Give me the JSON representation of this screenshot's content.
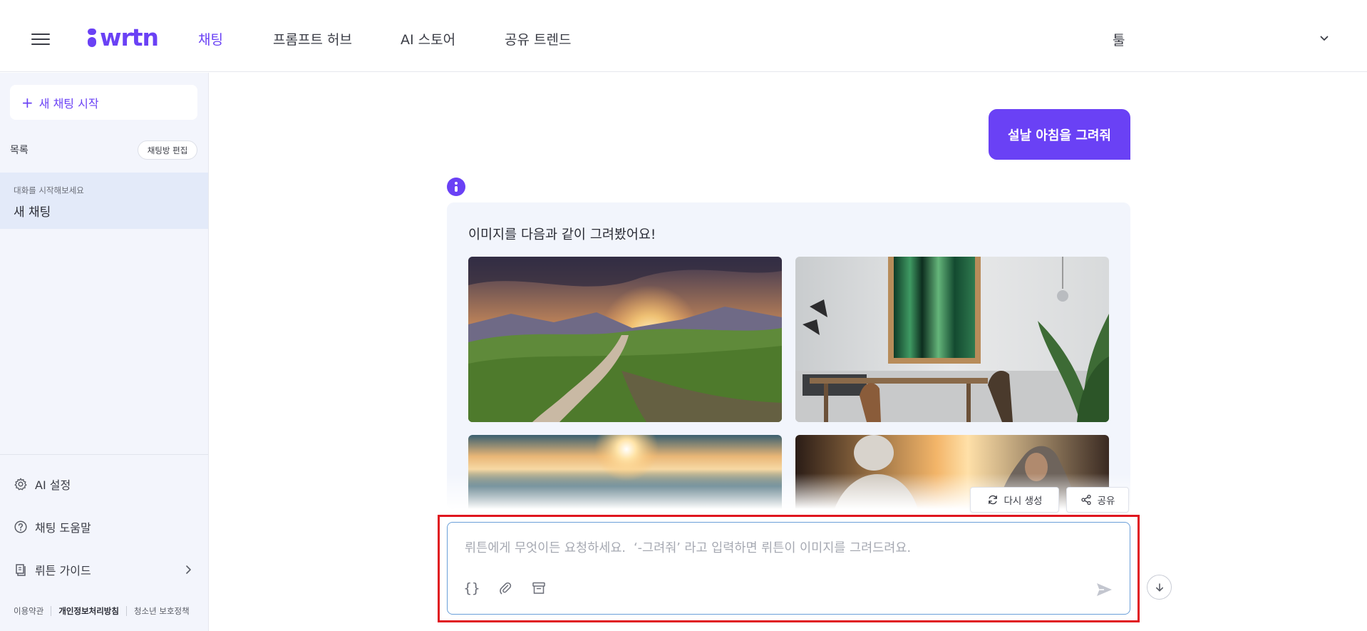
{
  "header": {
    "logo_text": "wrtn",
    "nav": [
      {
        "label": "채팅",
        "active": true
      },
      {
        "label": "프롬프트 허브",
        "active": false
      },
      {
        "label": "AI 스토어",
        "active": false
      },
      {
        "label": "공유 트렌드",
        "active": false
      }
    ],
    "tool_label": "툴",
    "icons": {
      "menu": "hamburger-icon",
      "dropdown": "chevron-down-icon"
    }
  },
  "sidebar": {
    "new_chat_label": "새 채팅 시작",
    "list_label": "목록",
    "edit_label": "채팅방 편집",
    "chats": [
      {
        "subtitle": "대화를 시작해보세요",
        "title": "새 채팅"
      }
    ],
    "menu": [
      {
        "label": "AI 설정",
        "icon": "gear-icon"
      },
      {
        "label": "채팅 도움말",
        "icon": "help-circle-icon"
      },
      {
        "label": "뤼튼 가이드",
        "icon": "book-icon"
      }
    ],
    "footer": [
      "이용약관",
      "개인정보처리방침",
      "청소년 보호정책"
    ]
  },
  "conversation": {
    "user_message": "설날 아침을 그려줘",
    "ai_message": "이미지를 다음과 같이 그려봤어요!",
    "images": [
      "mountain-valley-sunset",
      "green-abstract-art-room",
      "lake-sunrise",
      "two-people-winter-sunset"
    ]
  },
  "actions": {
    "regenerate_label": "다시 생성",
    "share_label": "공유"
  },
  "composer": {
    "placeholder": "뤼튼에게 무엇이든 요청하세요.  ‘-그려줘’ 라고 입력하면 뤼튼이 이미지를 그려드려요.",
    "value": "",
    "tools": [
      "curly-braces-icon",
      "paperclip-icon",
      "archive-icon"
    ]
  },
  "colors": {
    "brand": "#6a41f5",
    "sidebar_bg": "#f3f5fc",
    "highlight_border": "#e0161f"
  }
}
